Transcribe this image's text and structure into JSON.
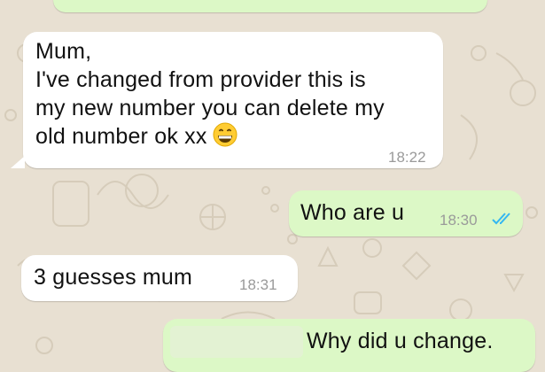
{
  "colors": {
    "wallpaper": "#e8e0d2",
    "incoming_bubble": "#ffffff",
    "outgoing_bubble": "#dcf8c6",
    "timestamp": "#9a9a9a",
    "read_ticks": "#34b7f1"
  },
  "messages": [
    {
      "direction": "incoming",
      "lines": [
        "Mum,",
        "I've changed from provider this is",
        "my new number you can delete my",
        "old number ok xx"
      ],
      "emoji": "grinning-face-icon",
      "time": "18:22"
    },
    {
      "direction": "outgoing",
      "text": "Who are u",
      "time": "18:30",
      "status": "read-double-check-icon"
    },
    {
      "direction": "incoming",
      "text": "3 guesses mum",
      "time": "18:31"
    },
    {
      "direction": "outgoing",
      "text": "Why did u change.",
      "note": "partially covered"
    }
  ]
}
